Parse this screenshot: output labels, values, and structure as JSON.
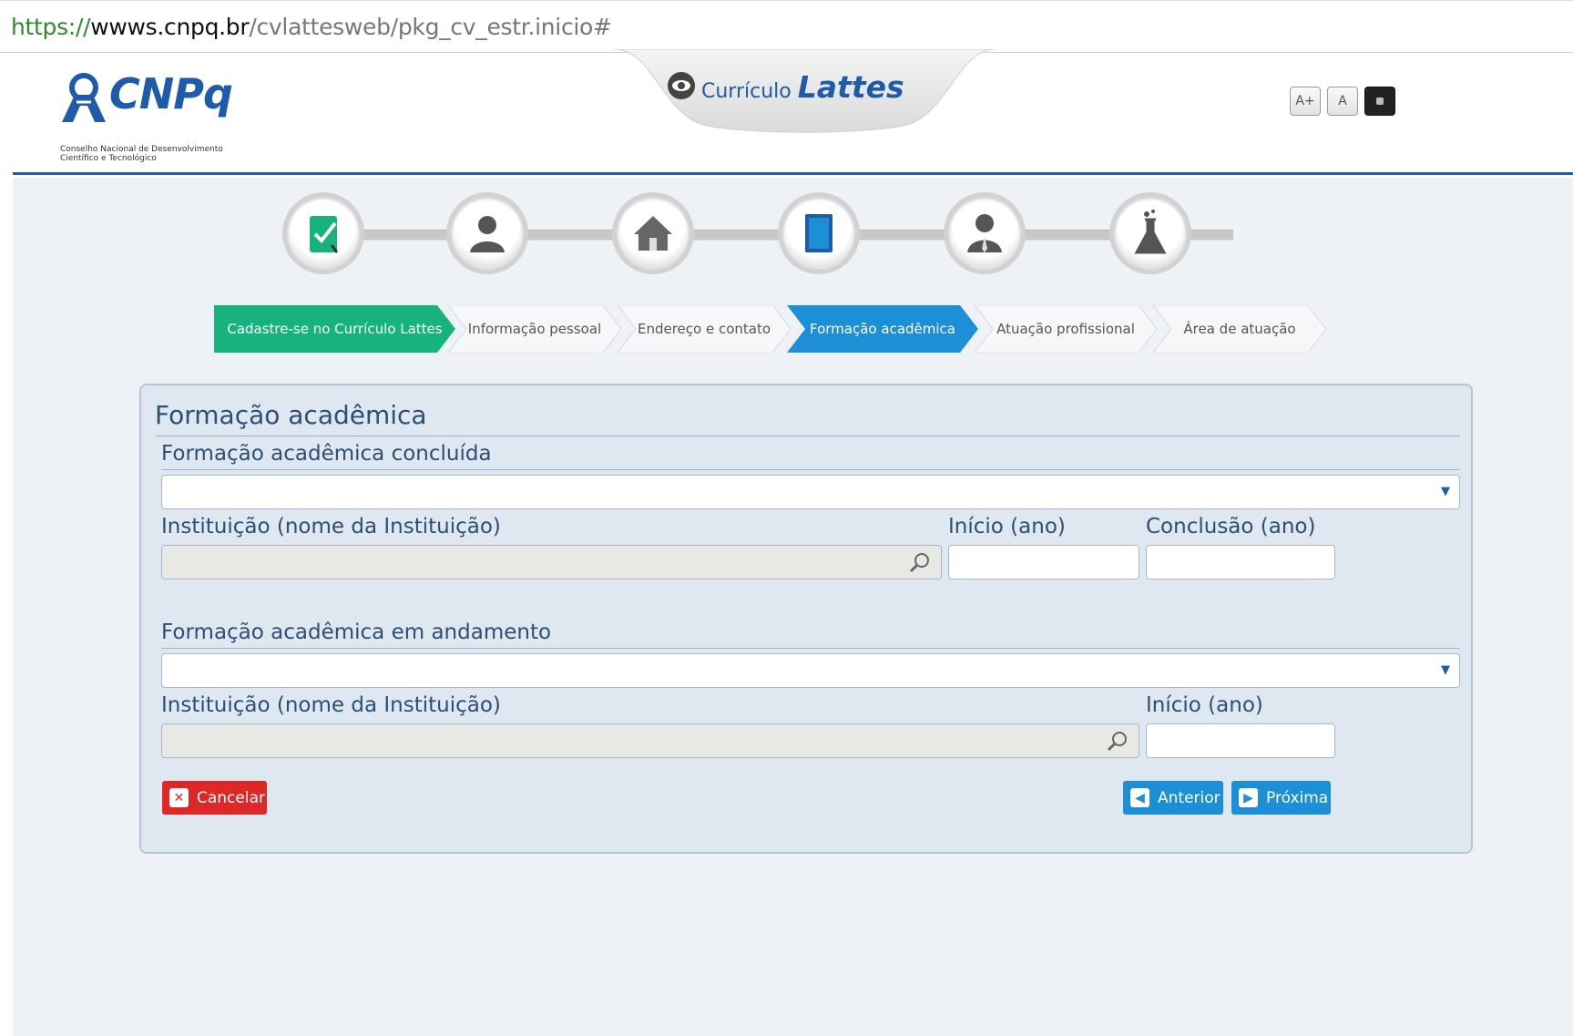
{
  "browser": {
    "url_scheme": "https://",
    "url_host": "wwws.cnpq.br",
    "url_path": "/cvlattesweb/pkg_cv_estr.inicio#"
  },
  "header": {
    "logo_text": "CNPq",
    "logo_subtitle_1": "Conselho Nacional de Desenvolvimento",
    "logo_subtitle_2": "Científico e Tecnológico",
    "app_title_prefix": "Currículo",
    "app_title_main": "Lattes",
    "font_buttons": [
      "A+",
      "A",
      ""
    ]
  },
  "steps": {
    "icons": [
      "checklist-icon",
      "person-icon",
      "house-icon",
      "book-icon",
      "professional-icon",
      "flask-icon"
    ],
    "breadcrumb": [
      {
        "label": "Cadastre-se no Currículo Lattes",
        "state": "done"
      },
      {
        "label": "Informação pessoal",
        "state": "todo"
      },
      {
        "label": "Endereço e contato",
        "state": "todo"
      },
      {
        "label": "Formação acadêmica",
        "state": "active"
      },
      {
        "label": "Atuação profissional",
        "state": "todo"
      },
      {
        "label": "Área de atuação",
        "state": "todo"
      }
    ]
  },
  "form": {
    "heading": "Formação acadêmica",
    "concluded": {
      "title": "Formação acadêmica concluída",
      "select_value": "",
      "institution_label": "Instituição (nome da Instituição)",
      "start_label": "Início (ano)",
      "end_label": "Conclusão (ano)"
    },
    "ongoing": {
      "title": "Formação acadêmica em andamento",
      "select_value": "",
      "institution_label": "Instituição (nome da Instituição)",
      "start_label": "Início (ano)"
    },
    "buttons": {
      "cancel": "Cancelar",
      "previous": "Anterior",
      "next": "Próxima"
    }
  },
  "colors": {
    "brand_blue": "#1e5ba8",
    "done_green": "#16b37c",
    "active_blue": "#1d8fd6",
    "cancel_red": "#e02727"
  }
}
